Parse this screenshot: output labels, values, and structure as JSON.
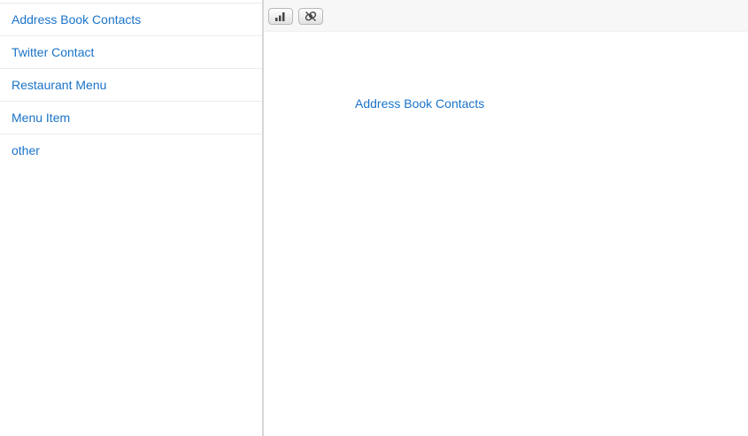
{
  "sidebar": {
    "items": [
      {
        "label": "Address Book Contacts"
      },
      {
        "label": "Twitter Contact"
      },
      {
        "label": "Restaurant Menu"
      },
      {
        "label": "Menu Item"
      },
      {
        "label": "other"
      }
    ]
  },
  "toolbar": {
    "buttons": [
      {
        "icon": "bar-chart-icon"
      },
      {
        "icon": "unlink-icon"
      }
    ]
  },
  "main": {
    "link_label": "Address Book Contacts"
  },
  "colors": {
    "link": "#1a73c9",
    "toolbar_bg": "#f7f7f7",
    "divider": "#d6d6d6"
  }
}
